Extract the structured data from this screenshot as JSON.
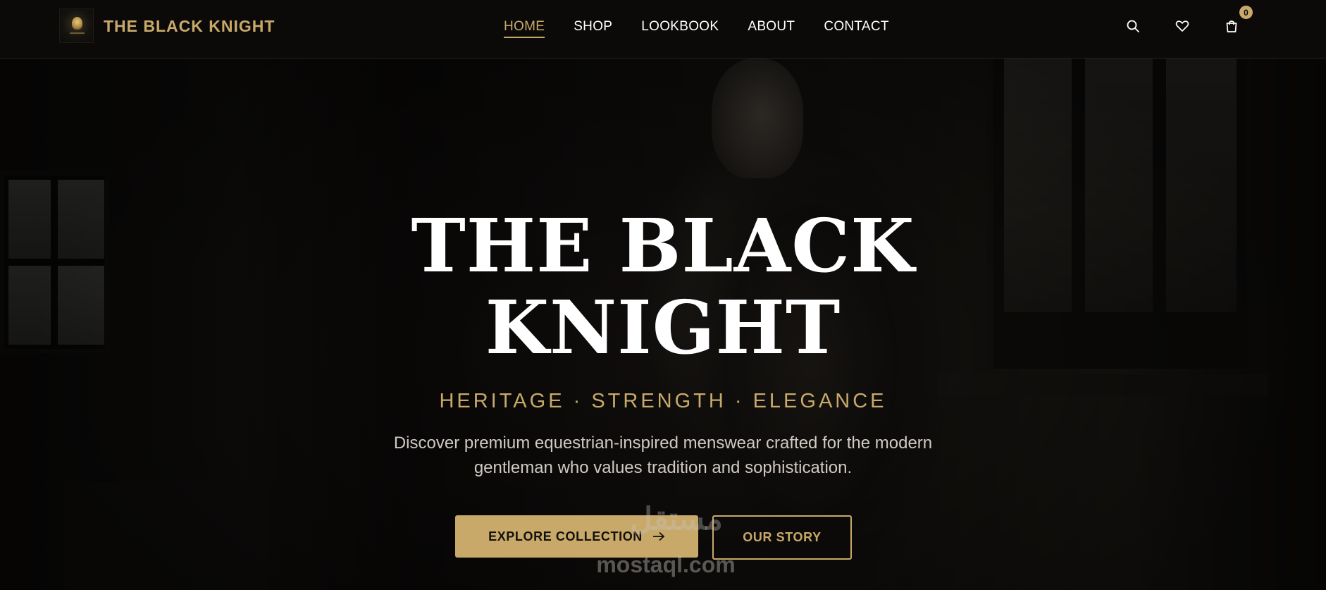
{
  "brand": {
    "name": "THE BLACK KNIGHT"
  },
  "nav": {
    "items": [
      {
        "label": "HOME",
        "active": true
      },
      {
        "label": "SHOP"
      },
      {
        "label": "LOOKBOOK"
      },
      {
        "label": "ABOUT"
      },
      {
        "label": "CONTACT"
      }
    ]
  },
  "header_actions": {
    "icons": [
      "search-icon",
      "heart-icon",
      "shopping-bag-icon"
    ],
    "cart_count": "0"
  },
  "hero": {
    "title_line1": "THE BLACK",
    "title_line2": "KNIGHT",
    "tagline": "HERITAGE · STRENGTH · ELEGANCE",
    "description": "Discover premium equestrian-inspired menswear crafted for the modern gentleman who values tradition and sophistication.",
    "primary_cta": "EXPLORE COLLECTION",
    "secondary_cta": "OUR STORY"
  },
  "watermark": {
    "latin": "mostaql.com",
    "arabic": "مستقل"
  },
  "colors": {
    "accent": "#c8a96a",
    "background": "#0b0a09",
    "text": "#ffffff"
  }
}
